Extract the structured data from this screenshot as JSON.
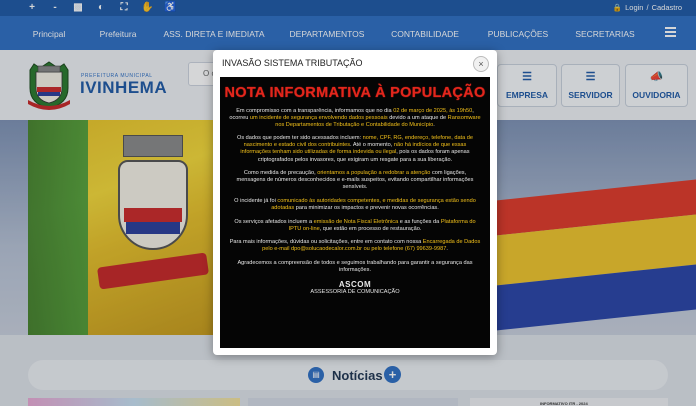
{
  "topbar": {
    "accessibility_icons": [
      "+",
      "-",
      "sitemap-icon",
      "contrast-icon",
      "fullscreen-icon",
      "libras-icon",
      "wheelchair-icon"
    ],
    "login_label": "Login",
    "separator": "/",
    "register_label": "Cadastro"
  },
  "nav": {
    "items": [
      "Principal",
      "Prefeitura",
      "ASS. DIRETA E IMEDIATA",
      "DEPARTAMENTOS",
      "CONTABILIDADE",
      "PUBLICAÇÕES",
      "SECRETARIAS"
    ]
  },
  "header": {
    "brand_small": "PREFEITURA MUNICIPAL",
    "brand": "IVINHEMA",
    "search_stub": "O c",
    "quick_links": [
      "EMPRESA",
      "SERVIDOR",
      "OUVIDORIA"
    ]
  },
  "news": {
    "title": "Notícias",
    "card_label": "INFORMATIVO ITR - 2024"
  },
  "modal": {
    "title": "INVASÃO SISTEMA TRIBUTAÇÃO",
    "close": "×",
    "headline": "NOTA INFORMATIVA À POPULAÇÃO",
    "p1": [
      "Em compromisso com a transparência, informamos que no dia ",
      "02 de março de 2025, às 19h50",
      ", ocorreu ",
      "um incidente de segurança envolvendo dados pessoais",
      " devido a um ataque de ",
      "Ransomware nos Departamentos de Tributação e Contabilidade do Município",
      "."
    ],
    "p2": [
      "Os dados que podem ter sido acessados incluem: ",
      "nome, CPF, RG, endereço, telefone, data de nascimento e estado civil dos contribuintes",
      ". Até o momento, ",
      "não há indícios de que essas informações tenham sido utilizadas de forma indevida ou ilegal",
      ", pois os dados foram apenas criptografados pelos invasores, que exigiram um resgate para a sua liberação."
    ],
    "p3": [
      "Como medida de precaução, ",
      "orientamos a população a redobrar a atenção",
      " com ligações, mensagens de números desconhecidos e e-mails suspeitos, evitando compartilhar informações sensíveis."
    ],
    "p4": [
      "O incidente já foi ",
      "comunicado às autoridades competentes, e medidas de segurança estão sendo adotadas",
      " para minimizar os impactos e prevenir novas ocorrências."
    ],
    "p5": [
      "Os serviços afetados incluem a ",
      "emissão de Nota Fiscal Eletrônica",
      " e as funções da ",
      "Plataforma do IPTU on-line",
      ", que estão em processo de restauração."
    ],
    "p6": [
      "Para mais informações, dúvidas ou solicitações, entre em contato com nossa ",
      "Encarregada de Dados pelo e-mail dpo@solucaodecalor.com.br ou pelo telefone (67) 99639-9987",
      "."
    ],
    "p7": "Agradecemos a compreensão de todos e seguimos trabalhando para garantir a segurança das informações.",
    "org": "ASCOM",
    "org_sub": "ASSESSORIA DE COMUNICAÇÃO",
    "highlight_color": "#f3c11a",
    "headline_color": "#e3261c"
  }
}
